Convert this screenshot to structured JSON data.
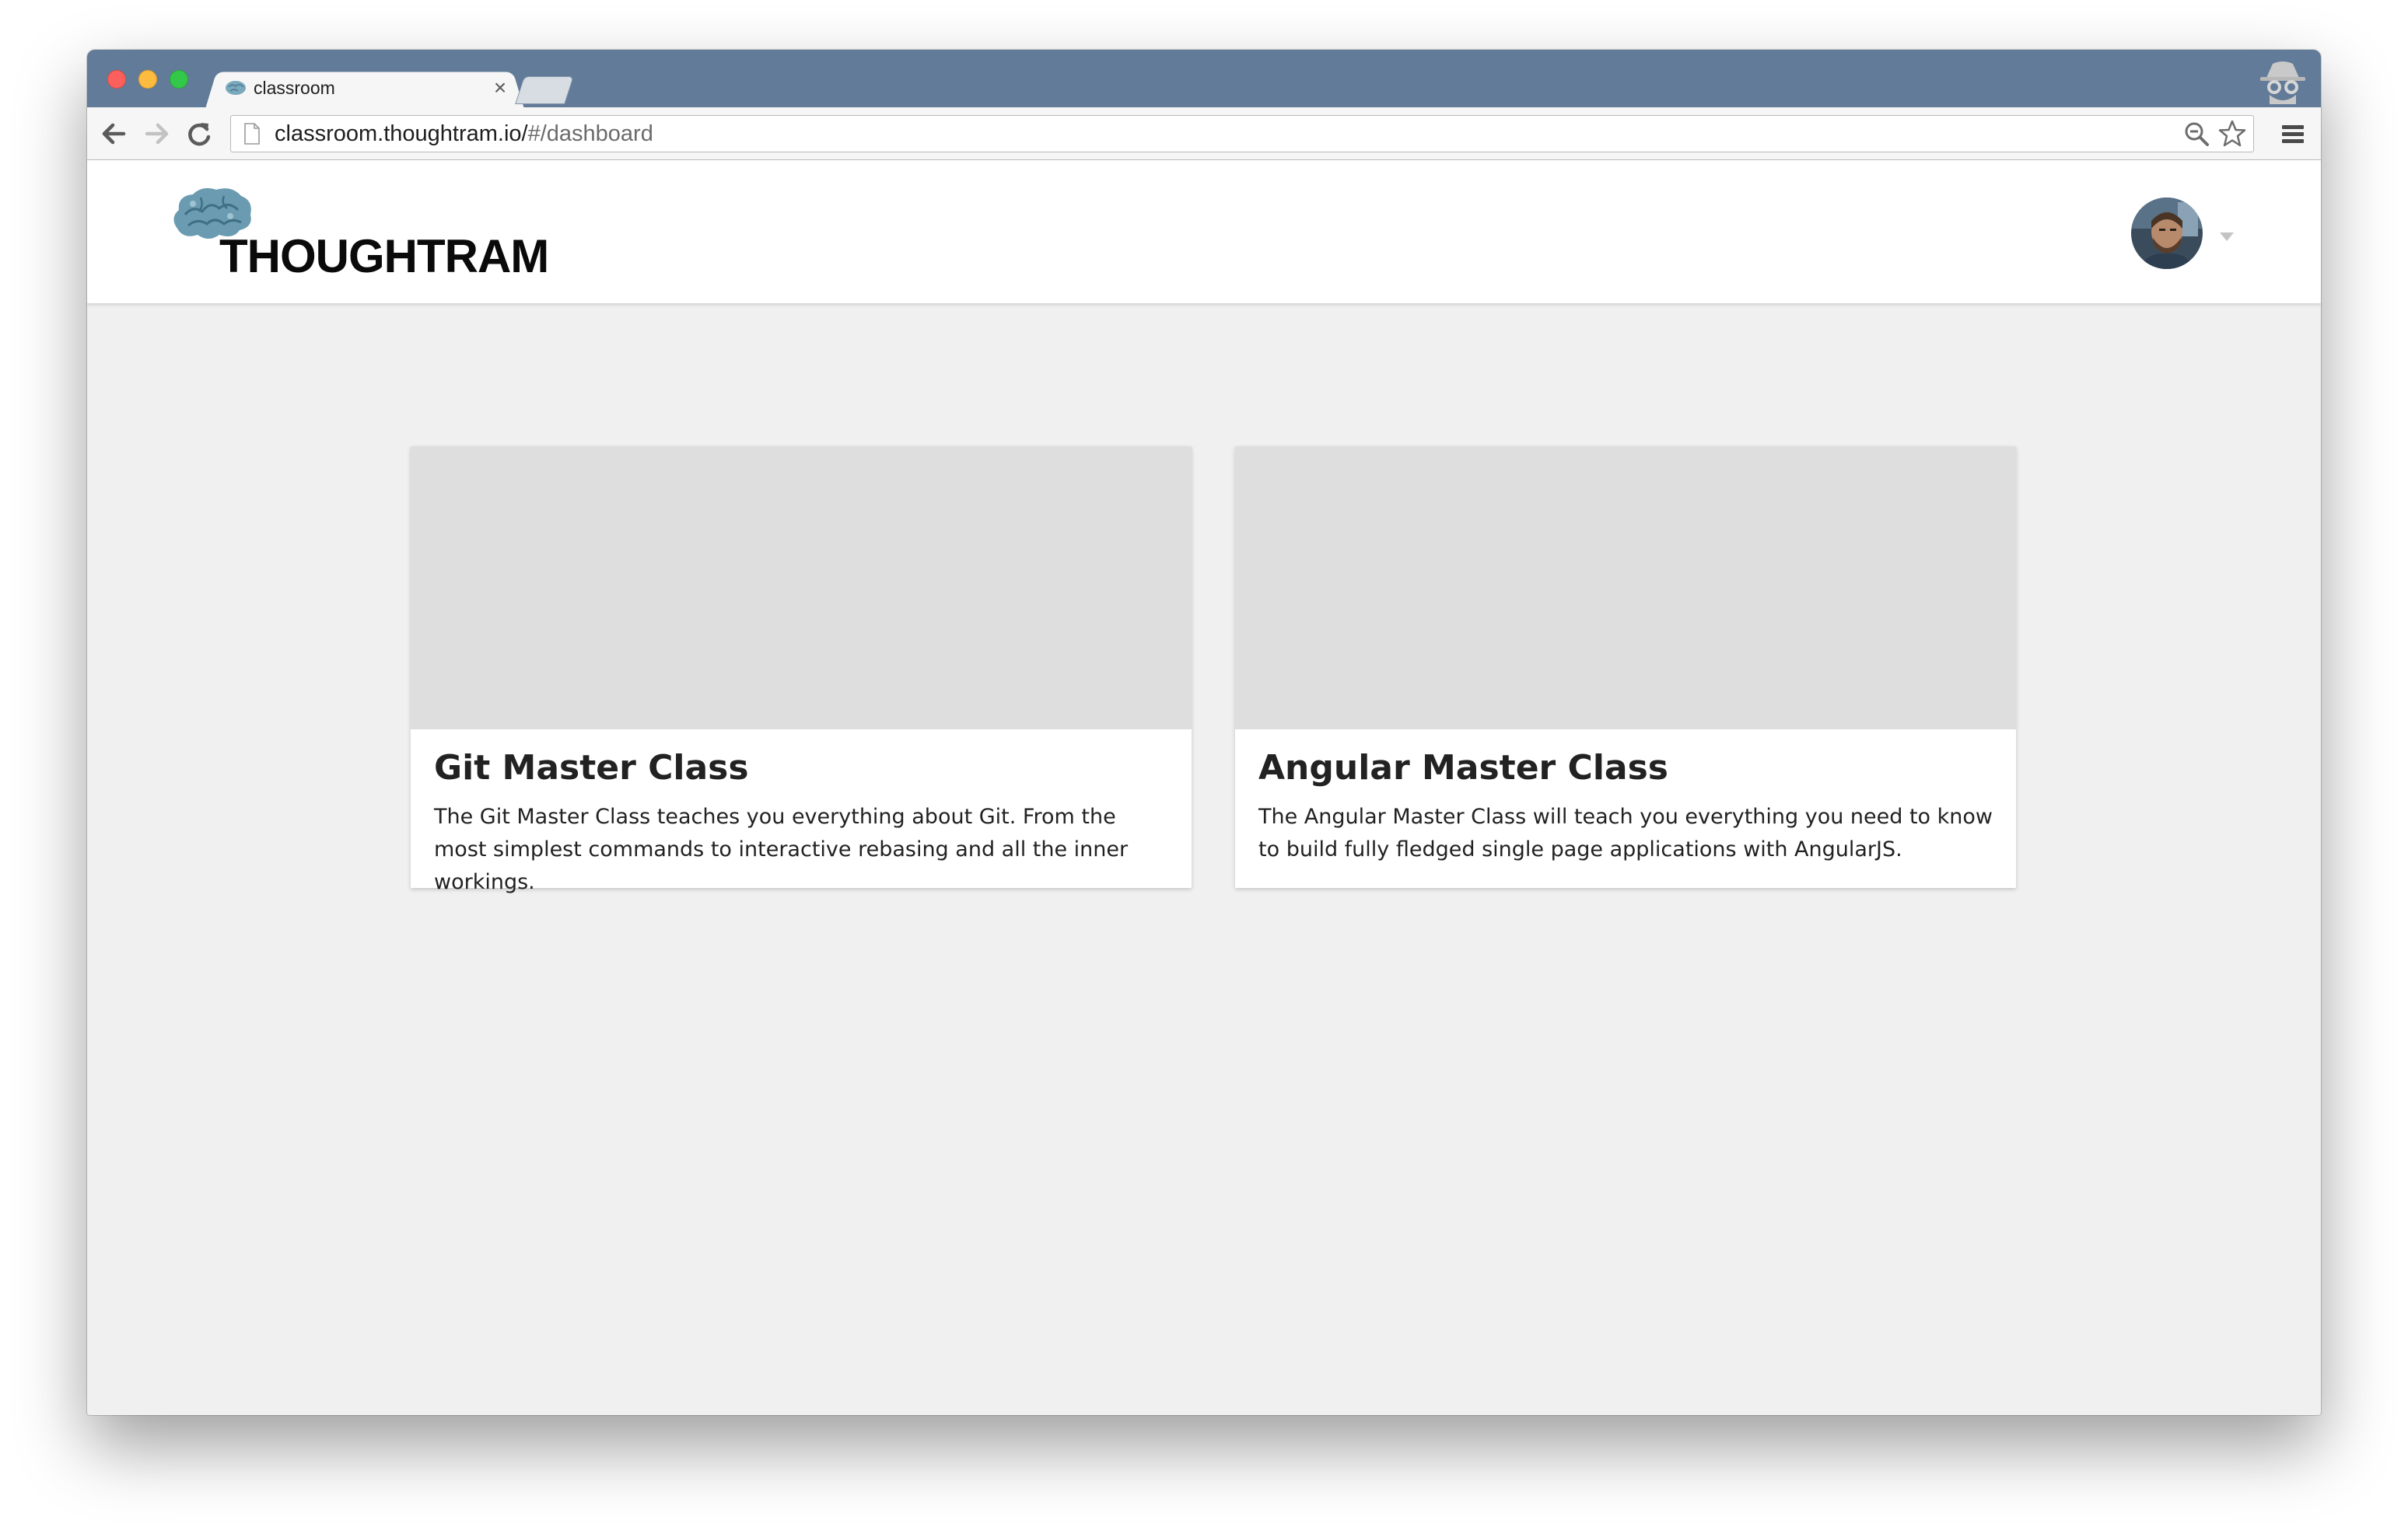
{
  "browser": {
    "tab_title": "classroom",
    "tab_close": "×",
    "url_host": "classroom.thoughtram.io/",
    "url_path": "#/dashboard"
  },
  "header": {
    "logo_text": "THOUGHTRAM",
    "logo_color": "#6a9bb0"
  },
  "courses": [
    {
      "title": "Git Master Class",
      "description": "The Git Master Class teaches you everything about Git. From the most simplest commands to interactive rebasing and all the inner workings."
    },
    {
      "title": "Angular Master Class",
      "description": "The Angular Master Class will teach you everything you need to know to build fully fledged single page applications with AngularJS."
    }
  ]
}
